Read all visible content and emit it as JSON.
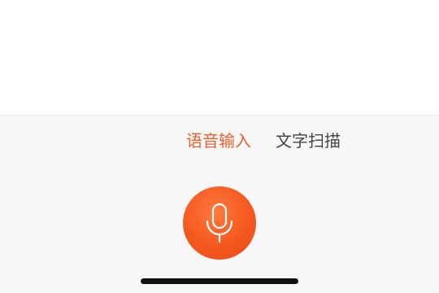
{
  "input_modes": {
    "tabs": [
      {
        "label": "语音输入",
        "active": true
      },
      {
        "label": "文字扫描",
        "active": false
      }
    ],
    "active_color": "#f0602a",
    "inactive_color": "#444444"
  },
  "mic_button": {
    "icon": "microphone-icon",
    "color": "#f4581f"
  }
}
